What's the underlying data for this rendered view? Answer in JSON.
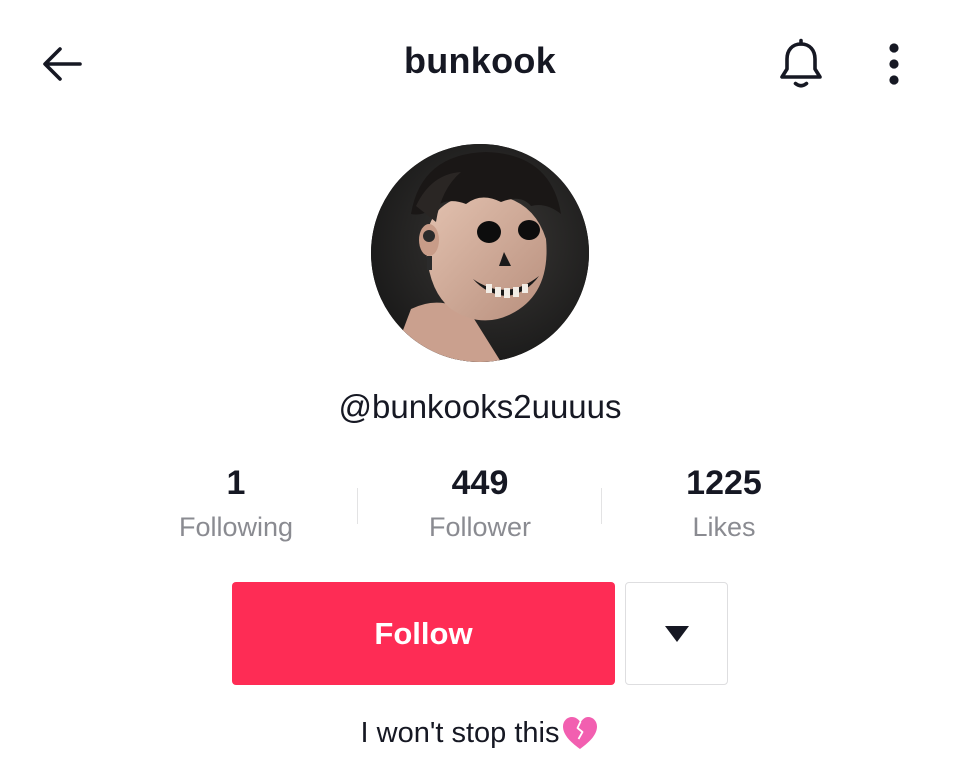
{
  "header": {
    "title": "bunkook",
    "back_icon": "arrow-left-icon",
    "bell_icon": "bell-icon",
    "more_icon": "more-vertical-icon"
  },
  "profile": {
    "username": "@bunkooks2uuuus",
    "avatar": "profile-photo"
  },
  "stats": [
    {
      "value": "1",
      "label": "Following"
    },
    {
      "value": "449",
      "label": "Follower"
    },
    {
      "value": "1225",
      "label": "Likes"
    }
  ],
  "actions": {
    "follow_label": "Follow",
    "dropdown_icon": "triangle-down-icon"
  },
  "bio": {
    "text": "I won't stop this",
    "emoji_icon": "broken-heart-icon"
  },
  "colors": {
    "accent": "#fe2c55",
    "text": "#161823",
    "muted": "#8a8b91",
    "emoji_pink": "#f25fb0"
  }
}
